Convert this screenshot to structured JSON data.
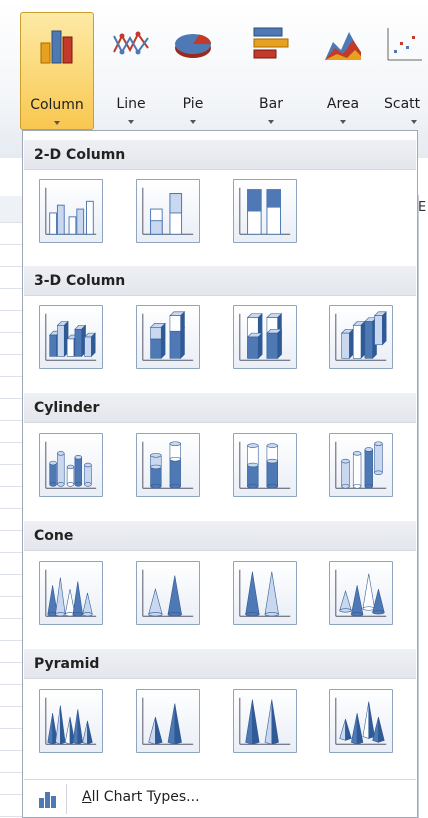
{
  "ribbon": {
    "buttons": [
      {
        "label": "Column",
        "icon": "column-chart-icon",
        "active": true
      },
      {
        "label": "Line",
        "icon": "line-chart-icon"
      },
      {
        "label": "Pie",
        "icon": "pie-chart-icon"
      },
      {
        "label": "Bar",
        "icon": "bar-chart-icon"
      },
      {
        "label": "Area",
        "icon": "area-chart-icon"
      },
      {
        "label": "Scatt",
        "icon": "scatter-chart-icon"
      }
    ]
  },
  "sheet": {
    "column_letter": "E"
  },
  "dropdown": {
    "sections": [
      {
        "title": "2-D Column",
        "count": 3
      },
      {
        "title": "3-D Column",
        "count": 4
      },
      {
        "title": "Cylinder",
        "count": 4
      },
      {
        "title": "Cone",
        "count": 4
      },
      {
        "title": "Pyramid",
        "count": 4
      }
    ],
    "footer": {
      "label": "All Chart Types...",
      "accel": "A",
      "rest": "ll Chart Types...",
      "icon": "column-chart-icon"
    }
  },
  "colors": {
    "accent": "#4f79b4",
    "active_bg": "#fbd877"
  }
}
